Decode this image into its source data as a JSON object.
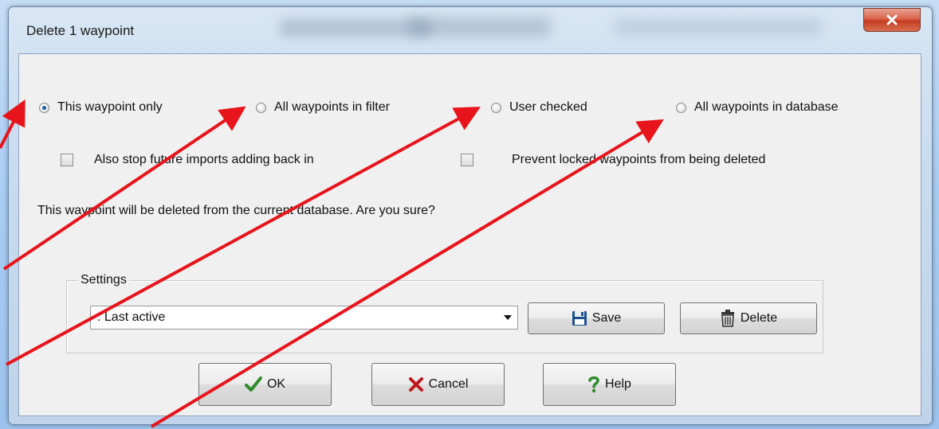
{
  "dialog": {
    "title": "Delete 1 waypoint",
    "close_label": "x"
  },
  "scope_options": [
    {
      "label": "This waypoint only",
      "checked": true
    },
    {
      "label": "All waypoints in filter",
      "checked": false
    },
    {
      "label": "User checked",
      "checked": false
    },
    {
      "label": "All waypoints in database",
      "checked": false
    }
  ],
  "checkboxes": [
    {
      "label": "Also stop future imports adding back in",
      "checked": false
    },
    {
      "label": "Prevent locked waypoints from being deleted",
      "checked": false
    }
  ],
  "confirm_message": "This waypoint will be deleted from the current database. Are you sure?",
  "settings": {
    "legend": "Settings",
    "selected": ". Last active",
    "save_label": "Save",
    "delete_label": "Delete"
  },
  "buttons": {
    "ok_label": "OK",
    "cancel_label": "Cancel",
    "help_label": "Help"
  },
  "icons": {
    "ok": "checkmark-icon",
    "cancel": "x-mark-icon",
    "help": "question-mark-icon",
    "save": "floppy-disk-icon",
    "delete": "trash-can-icon"
  },
  "colors": {
    "annotation_arrow": "#e8141b",
    "close_button": "#c53c1f",
    "radio_selected": "#1f5fa5"
  }
}
